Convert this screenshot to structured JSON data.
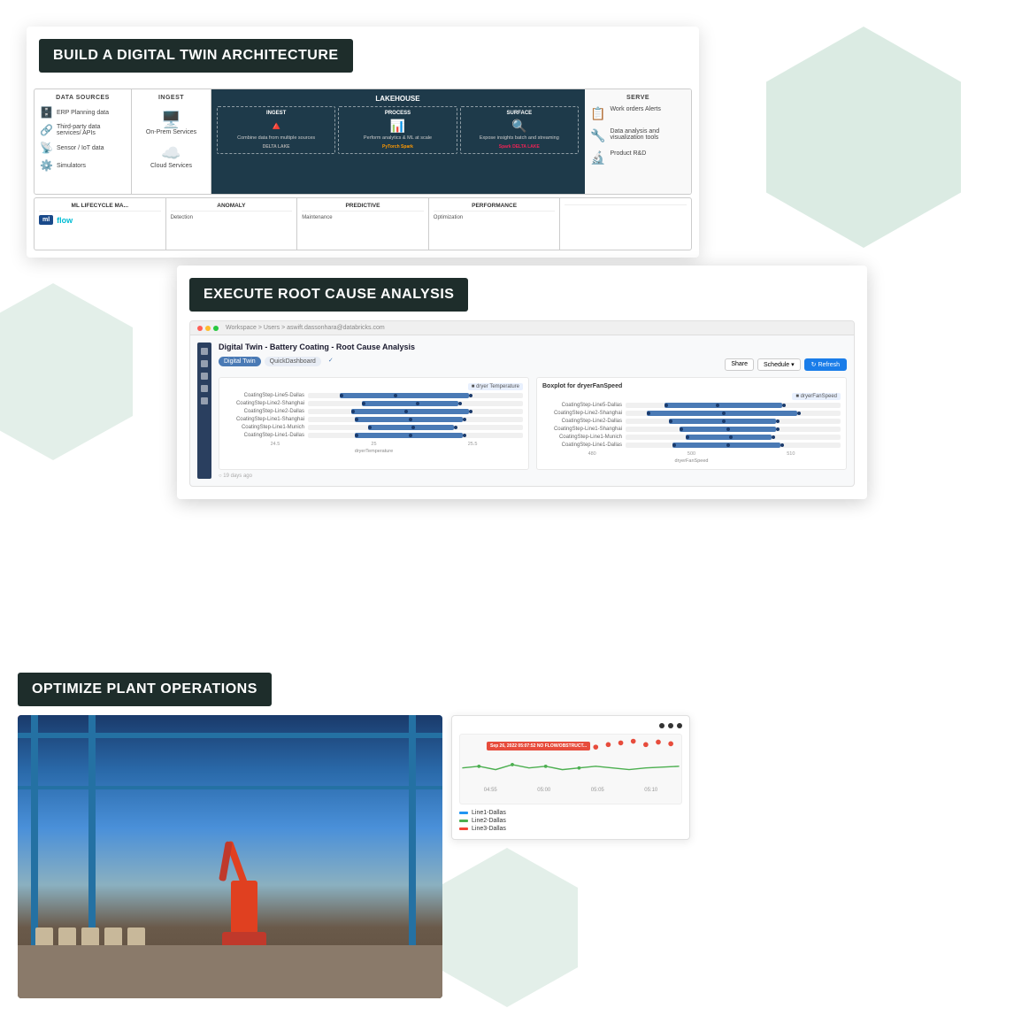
{
  "page": {
    "background": "#ffffff"
  },
  "card1": {
    "title": "BUILD A DIGITAL TWIN ARCHITECTURE",
    "data_sources": {
      "header": "DATA SOURCES",
      "items": [
        {
          "icon": "🗄️",
          "label": "ERP Planning data"
        },
        {
          "icon": "🔗",
          "label": "Third-party data services/ APIs"
        },
        {
          "icon": "📡",
          "label": "Sensor / IoT data"
        },
        {
          "icon": "⚙️",
          "label": "Simulators"
        }
      ]
    },
    "ingest": {
      "header": "INGEST",
      "items": [
        {
          "icon": "🖥️",
          "label": "On-Prem Services"
        },
        {
          "icon": "☁️",
          "label": "Cloud Services"
        }
      ]
    },
    "lakehouse": {
      "header": "LAKEHOUSE",
      "sub_sections": [
        {
          "header": "INGEST",
          "text": "Combine data from multiple sources",
          "logo": "DELTA LAKE"
        },
        {
          "header": "PROCESS",
          "text": "Perform analytics & ML at scale",
          "logos": [
            "PyTorch",
            "Spark"
          ]
        },
        {
          "header": "SURFACE",
          "text": "Expose insights batch and streaming",
          "logos": [
            "Spark",
            "DELTA LAKE"
          ]
        }
      ]
    },
    "serve": {
      "header": "SERVE",
      "items": [
        {
          "icon": "📋",
          "label": "Work orders Alerts"
        },
        {
          "icon": "🔧",
          "label": "Data analysis and visualization tools"
        },
        {
          "icon": "🔬",
          "label": "Product R&D"
        }
      ]
    },
    "ml_row": {
      "sections": [
        {
          "header": "ML LIFECYCLE MA...",
          "text": ""
        },
        {
          "header": "ANOMALY",
          "text": ""
        },
        {
          "header": "PREDICTIVE",
          "text": ""
        },
        {
          "header": "PERFORMANCE",
          "text": ""
        }
      ]
    }
  },
  "card2": {
    "title": "EXECUTE ROOT CAUSE ANALYSIS",
    "url": "Workspace > Users > aswift.dassonhara@databricks.com",
    "dashboard_title": "Digital Twin - Battery Coating - Root Cause Analysis",
    "tabs": [
      "Digital Twin",
      "QuickDashboard"
    ],
    "buttons": [
      "Share",
      "Schedule",
      "Refresh"
    ],
    "chart1": {
      "title": "dryer Temperature",
      "legend": "dryer Temperature",
      "rows": [
        {
          "label": "CoatingStep-Line5-Dallas"
        },
        {
          "label": "CoatingStep-Line2-Shanghai"
        },
        {
          "label": "CoatingStep-Line2-Dallas"
        },
        {
          "label": "CoatingStep-Line1-Shanghai"
        },
        {
          "label": "CoatingStep-Line1-Munich"
        },
        {
          "label": "CoatingStep-Line1-Dallas"
        }
      ]
    },
    "chart2": {
      "title": "Boxplot for dryerFanSpeed",
      "legend": "dryerFanSpeed",
      "rows": [
        {
          "label": "CoatingStep-Line5-Dallas"
        },
        {
          "label": "CoatingStep-Line2-Shanghai"
        },
        {
          "label": "CoatingStep-Line2-Dallas"
        },
        {
          "label": "CoatingStep-Line1-Shanghai"
        },
        {
          "label": "CoatingStep-Line1-Munich"
        },
        {
          "label": "CoatingStep-Line1-Dallas"
        }
      ]
    },
    "mlflow_label": "ml",
    "mlflow_flow": "flow"
  },
  "card3": {
    "title": "OPTIMIZE PLANT OPERATIONS",
    "chart": {
      "time_labels": [
        "04:55",
        "05:00",
        "05:05",
        "05:10"
      ],
      "legend": [
        {
          "label": "Line1-Dallas",
          "color": "#2196f3"
        },
        {
          "label": "Line2-Dallas",
          "color": "#4caf50"
        },
        {
          "label": "Line3-Dallas",
          "color": "#f44336"
        }
      ],
      "alert_text": "Sep 26, 2022 05:07:52 NO FLOW/OBSTRUCT..."
    }
  }
}
